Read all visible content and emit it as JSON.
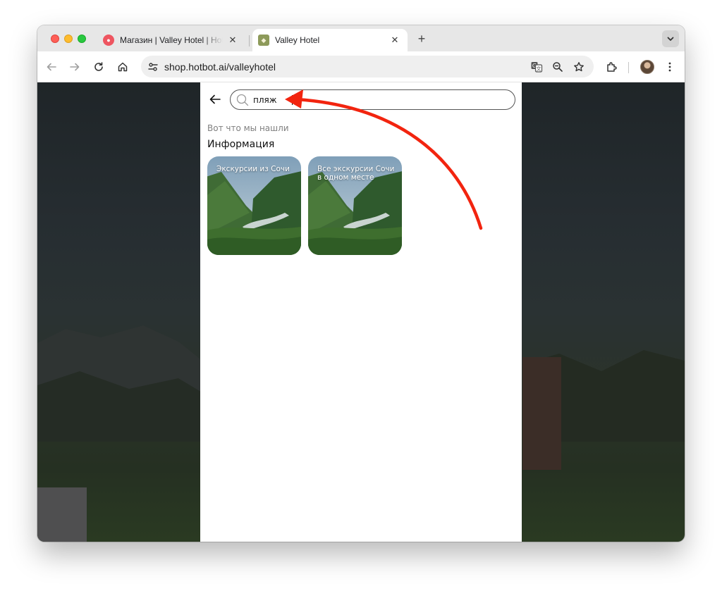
{
  "browser": {
    "tabs": [
      {
        "title": "Магазин | Valley Hotel | Hotbot",
        "favicon": "hotbot-flame-icon",
        "active": false
      },
      {
        "title": "Valley Hotel",
        "favicon": "valley-hotel-icon",
        "active": true
      }
    ],
    "close_glyph": "✕",
    "new_tab_glyph": "+",
    "url": "shop.hotbot.ai/valleyhotel"
  },
  "page": {
    "search": {
      "value": "пляж",
      "placeholder": ""
    },
    "results_caption": "Вот что мы нашли",
    "section_title": "Информация",
    "cards": [
      {
        "label": "Экскурсии из Сочи"
      },
      {
        "label": "Все экскурсии Сочи в одном месте"
      }
    ]
  },
  "colors": {
    "annotation_arrow": "#f2240f",
    "page_background": "#ffffff",
    "dim_overlay": "#1f2528"
  }
}
